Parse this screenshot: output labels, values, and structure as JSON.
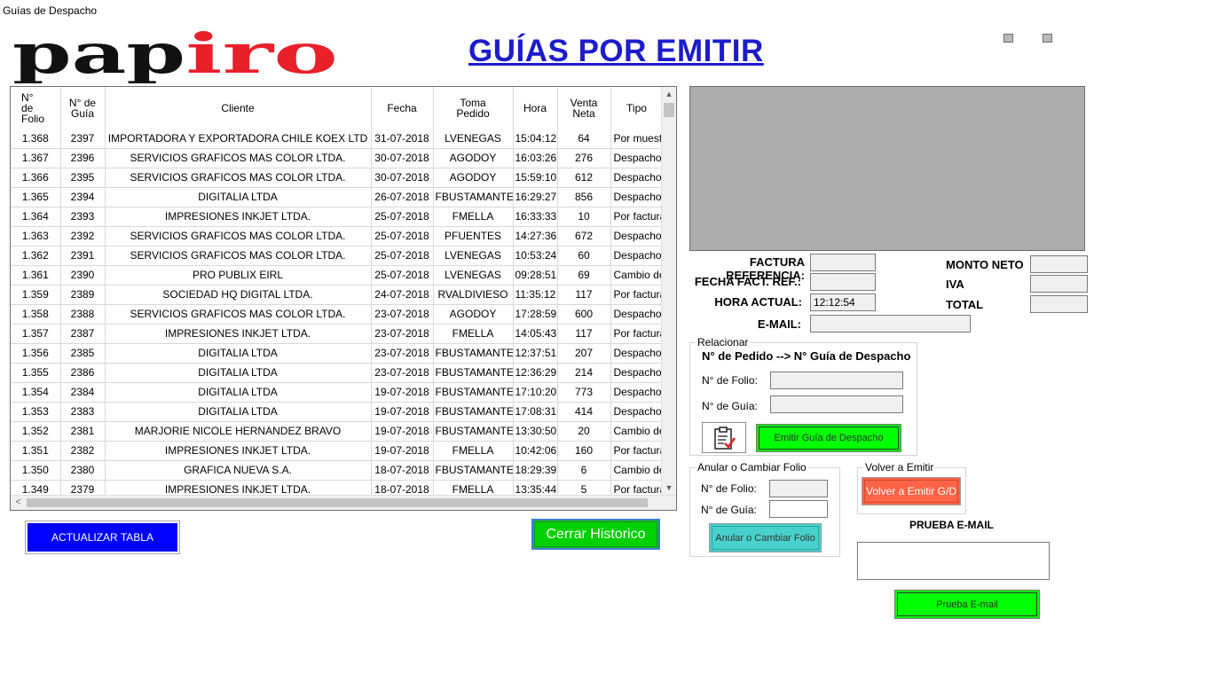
{
  "window": {
    "title": "Guías de Despacho"
  },
  "logo": {
    "part1": "pap",
    "part2": "iro",
    "i_letter": "i"
  },
  "header": {
    "title": "GUÍAS POR EMITIR"
  },
  "grid": {
    "columns": [
      {
        "l1": "N°",
        "l2": "de",
        "l3": "Folio"
      },
      {
        "l1": "N° de",
        "l2": "Guía",
        "l3": ""
      },
      {
        "l1": "Cliente",
        "l2": "",
        "l3": ""
      },
      {
        "l1": "Fecha",
        "l2": "",
        "l3": ""
      },
      {
        "l1": "Toma",
        "l2": "Pedido",
        "l3": ""
      },
      {
        "l1": "Hora",
        "l2": "",
        "l3": ""
      },
      {
        "l1": "Venta",
        "l2": "Neta",
        "l3": ""
      },
      {
        "l1": "Tipo",
        "l2": "",
        "l3": ""
      }
    ],
    "rows": [
      [
        "1.368",
        "2397",
        "IMPORTADORA Y EXPORTADORA CHILE KOEX LTD",
        "31-07-2018",
        "LVENEGAS",
        "15:04:12",
        "64",
        "Por muestra"
      ],
      [
        "1.367",
        "2396",
        "SERVICIOS GRAFICOS MAS COLOR LTDA.",
        "30-07-2018",
        "AGODOY",
        "16:03:26",
        "276",
        "Despacho p"
      ],
      [
        "1.366",
        "2395",
        "SERVICIOS GRAFICOS MAS COLOR LTDA.",
        "30-07-2018",
        "AGODOY",
        "15:59:10",
        "612",
        "Despacho p"
      ],
      [
        "1.365",
        "2394",
        "DIGITALIA LTDA",
        "26-07-2018",
        "FBUSTAMANTE",
        "16:29:27",
        "856",
        "Despacho p"
      ],
      [
        "1.364",
        "2393",
        "IMPRESIONES INKJET LTDA.",
        "25-07-2018",
        "FMELLA",
        "16:33:33",
        "10",
        "Por facturar"
      ],
      [
        "1.363",
        "2392",
        "SERVICIOS GRAFICOS MAS COLOR LTDA.",
        "25-07-2018",
        "PFUENTES",
        "14:27:36",
        "672",
        "Despacho p"
      ],
      [
        "1.362",
        "2391",
        "SERVICIOS GRAFICOS MAS COLOR LTDA.",
        "25-07-2018",
        "LVENEGAS",
        "10:53:24",
        "60",
        "Despacho p"
      ],
      [
        "1.361",
        "2390",
        "PRO PUBLIX EIRL",
        "25-07-2018",
        "LVENEGAS",
        "09:28:51",
        "69",
        "Cambio de m"
      ],
      [
        "1.359",
        "2389",
        "SOCIEDAD HQ DIGITAL LTDA.",
        "24-07-2018",
        "RVALDIVIESO",
        "11:35:12",
        "117",
        "Por facturar"
      ],
      [
        "1.358",
        "2388",
        "SERVICIOS GRAFICOS MAS COLOR LTDA.",
        "23-07-2018",
        "AGODOY",
        "17:28:59",
        "600",
        "Despacho p"
      ],
      [
        "1.357",
        "2387",
        "IMPRESIONES INKJET LTDA.",
        "23-07-2018",
        "FMELLA",
        "14:05:43",
        "117",
        "Por facturar"
      ],
      [
        "1.356",
        "2385",
        "DIGITALIA LTDA",
        "23-07-2018",
        "FBUSTAMANTE",
        "12:37:51",
        "207",
        "Despacho p"
      ],
      [
        "1.355",
        "2386",
        "DIGITALIA LTDA",
        "23-07-2018",
        "FBUSTAMANTE",
        "12:36:29",
        "214",
        "Despacho p"
      ],
      [
        "1.354",
        "2384",
        "DIGITALIA LTDA",
        "19-07-2018",
        "FBUSTAMANTE",
        "17:10:20",
        "773",
        "Despacho p"
      ],
      [
        "1.353",
        "2383",
        "DIGITALIA LTDA",
        "19-07-2018",
        "FBUSTAMANTE",
        "17:08:31",
        "414",
        "Despacho p"
      ],
      [
        "1.352",
        "2381",
        "MARJORIE NICOLE HERNANDEZ BRAVO",
        "19-07-2018",
        "FBUSTAMANTE",
        "13:30:50",
        "20",
        "Cambio de m"
      ],
      [
        "1.351",
        "2382",
        "IMPRESIONES INKJET LTDA.",
        "19-07-2018",
        "FMELLA",
        "10:42:06",
        "160",
        "Por facturar"
      ],
      [
        "1.350",
        "2380",
        "GRAFICA NUEVA S.A.",
        "18-07-2018",
        "FBUSTAMANTE",
        "18:29:39",
        "6",
        "Cambio de m"
      ],
      [
        "1.349",
        "2379",
        "IMPRESIONES INKJET LTDA.",
        "18-07-2018",
        "FMELLA",
        "13:35:44",
        "5",
        "Por facturar"
      ]
    ]
  },
  "buttons": {
    "actualizar": "ACTUALIZAR TABLA",
    "cerrar": "Cerrar Historico",
    "emitir": "Emitir Guía de Despacho",
    "volver": "Volver a Emitir G/D",
    "anular": "Anular o Cambiar Folio",
    "prueba": "Prueba E-mail"
  },
  "form": {
    "factura_ref_label": "FACTURA REFERENCIA:",
    "fecha_fact_label": "FECHA FACT. REF.:",
    "hora_actual_label": "HORA ACTUAL:",
    "hora_actual_value": "12:12:54",
    "email_label": "E-MAIL:",
    "monto_neto_label": "MONTO NETO",
    "iva_label": "IVA",
    "total_label": "TOTAL"
  },
  "relacionar": {
    "title": "Relacionar",
    "subtitle": "N° de Pedido --> N° Guía de Despacho",
    "folio_label": "N° de Folio:",
    "guia_label": "N° de Guía:"
  },
  "anular": {
    "title": "Anular o Cambiar Folio",
    "folio_label": "N° de Folio:",
    "guia_label": "N° de Guía:"
  },
  "volver": {
    "title": "Volver a Emitir"
  },
  "prueba": {
    "label": "PRUEBA E-MAIL"
  },
  "colors": {
    "title_blue": "#1c1ccc",
    "logo_red": "#e8202a",
    "btn_blue": "#0000ff",
    "btn_green": "#00ff00",
    "btn_red": "#ff6347",
    "btn_teal": "#48d1cc"
  }
}
